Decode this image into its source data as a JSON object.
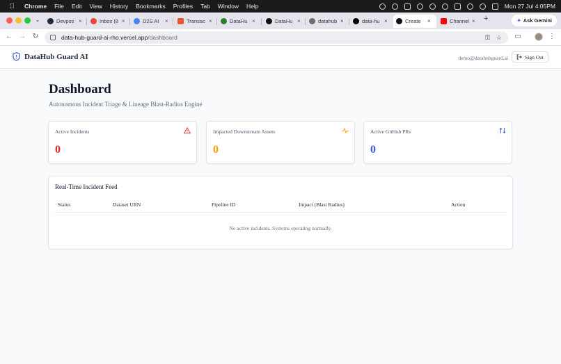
{
  "os_menubar": {
    "app": "Chrome",
    "menus": [
      "File",
      "Edit",
      "View",
      "History",
      "Bookmarks",
      "Profiles",
      "Tab",
      "Window",
      "Help"
    ],
    "clock": "Mon 27 Jul  4:05PM"
  },
  "browser": {
    "tabs": [
      {
        "title": "Devpos",
        "color": "#1f2937"
      },
      {
        "title": "Inbox (8",
        "color": "#ea4335"
      },
      {
        "title": "D2S AI",
        "color": "#4285f4"
      },
      {
        "title": "Transac",
        "color": "#e4572e"
      },
      {
        "title": "DataHu",
        "color": "#2e7d32"
      },
      {
        "title": "DataHu",
        "color": "#111111"
      },
      {
        "title": "datahub",
        "color": "#6b6b70"
      },
      {
        "title": "data-hu",
        "color": "#000000"
      },
      {
        "title": "Create",
        "color": "#111111"
      },
      {
        "title": "Channel",
        "color": "#ff0000"
      }
    ],
    "new_tab_label": "+",
    "ask_gemini_label": "Ask Gemini",
    "url_host": "data-hub-guard-ai-rho.vercel.app",
    "url_path": "/dashboard"
  },
  "app": {
    "brand": "DataHub Guard AI",
    "user_email": "demo@datahubguard.ai",
    "sign_out_label": "Sign Out",
    "page_title": "Dashboard",
    "page_subtitle": "Autonomous Incident Triage & Lineage Blast-Radius Engine",
    "cards": [
      {
        "label": "Active Incidents",
        "value": "0",
        "color": "#dc2626",
        "icon": "alert-triangle-icon"
      },
      {
        "label": "Impacted Downstream Assets",
        "value": "0",
        "color": "#f59e0b",
        "icon": "activity-icon"
      },
      {
        "label": "Active GitHub PRs",
        "value": "0",
        "color": "#3b5bdb",
        "icon": "git-pull-request-icon"
      }
    ],
    "feed": {
      "title": "Real-Time Incident Feed",
      "columns": [
        "Status",
        "Dataset URN",
        "Pipeline ID",
        "Impact (Blast Radius)",
        "Action"
      ],
      "empty_message": "No active incidents. Systems operating normally."
    }
  }
}
